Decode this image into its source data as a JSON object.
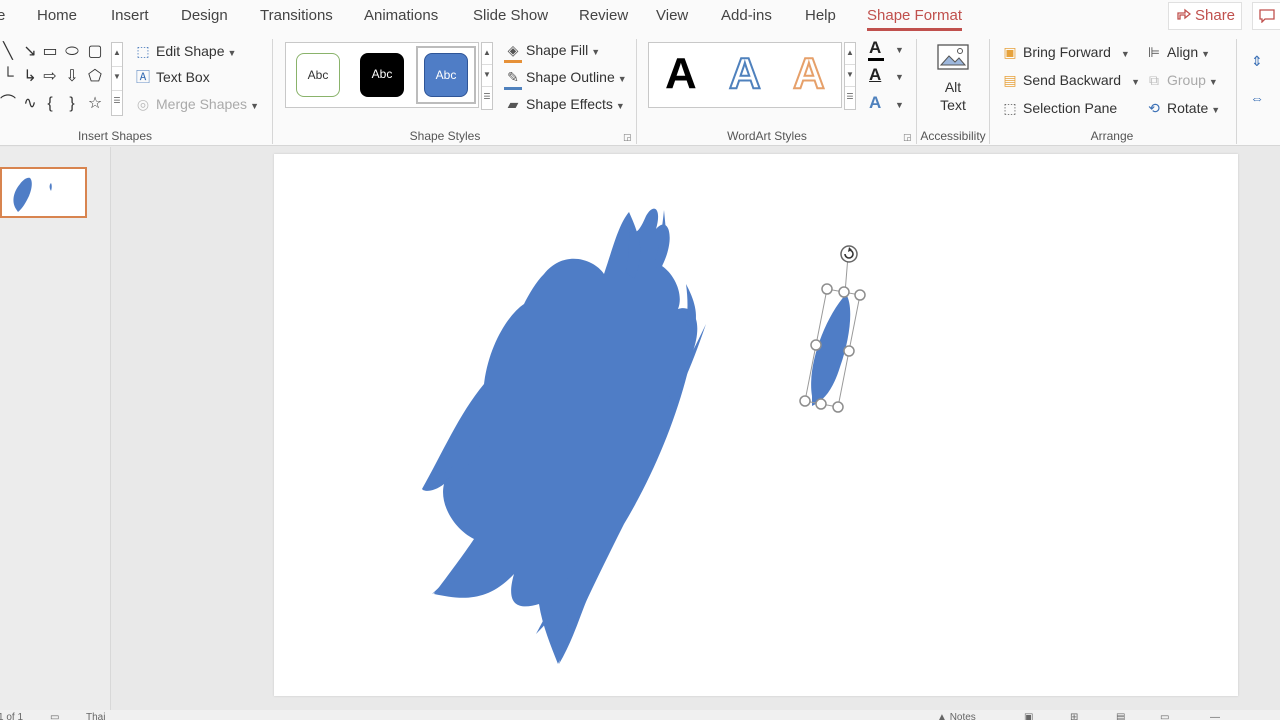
{
  "tabs": [
    {
      "label": "e"
    },
    {
      "label": "Home"
    },
    {
      "label": "Insert"
    },
    {
      "label": "Design"
    },
    {
      "label": "Transitions"
    },
    {
      "label": "Animations"
    },
    {
      "label": "Slide Show"
    },
    {
      "label": "Review"
    },
    {
      "label": "View"
    },
    {
      "label": "Add-ins"
    },
    {
      "label": "Help"
    },
    {
      "label": "Shape Format"
    }
  ],
  "share_label": "Share",
  "ribbon": {
    "insert_shapes": {
      "label": "Insert Shapes",
      "edit_shape": "Edit Shape",
      "text_box": "Text Box",
      "merge_shapes": "Merge Shapes"
    },
    "shape_styles": {
      "label": "Shape Styles",
      "swatches": [
        "Abc",
        "Abc",
        "Abc"
      ],
      "shape_fill": "Shape Fill",
      "shape_outline": "Shape Outline",
      "shape_effects": "Shape Effects"
    },
    "wordart_styles": {
      "label": "WordArt Styles",
      "letters": [
        "A",
        "A",
        "A"
      ],
      "small_letters": [
        "A",
        "A",
        "A"
      ]
    },
    "accessibility": {
      "label": "Accessibility",
      "alt_text_line1": "Alt",
      "alt_text_line2": "Text"
    },
    "arrange": {
      "label": "Arrange",
      "bring_forward": "Bring Forward",
      "send_backward": "Send Backward",
      "selection_pane": "Selection Pane",
      "align": "Align",
      "group": "Group",
      "rotate": "Rotate"
    }
  },
  "status": {
    "slide_of": "1 of 1",
    "language": "Thai",
    "notes": "Notes"
  },
  "colors": {
    "accent": "#c0504d",
    "shape_blue": "#4f7dc6",
    "wordart_blue": "#4f81bd",
    "wordart_orange": "#e6a06a"
  },
  "icons": {
    "share": "share-icon",
    "alt_text": "alt-text-picture-icon",
    "rotate_handle": "rotate-handle-icon"
  }
}
